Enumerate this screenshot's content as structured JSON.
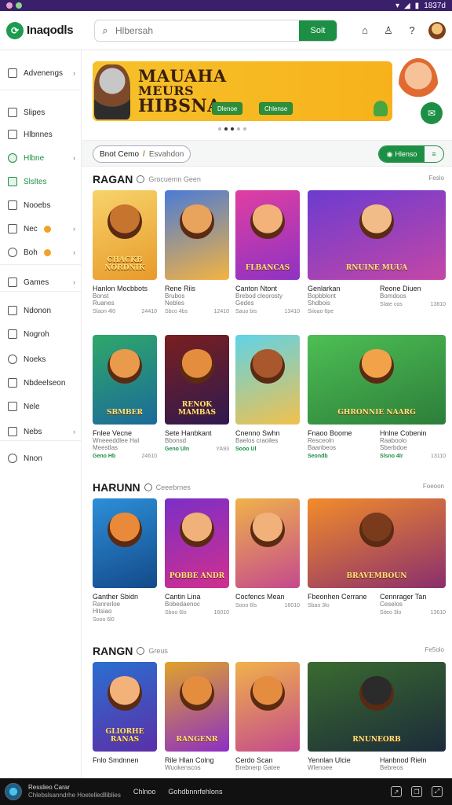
{
  "statusbar": {
    "time": "1837d"
  },
  "header": {
    "logo_text": "Inaqodls",
    "search_placeholder": "Hlbersah",
    "search_button": "Soit"
  },
  "sidebar": {
    "items": [
      {
        "label": "Advenengs",
        "icon": "home-icon"
      },
      {
        "label": "Slipes",
        "icon": "house-icon"
      },
      {
        "label": "Hlbnnes",
        "icon": "list-icon"
      },
      {
        "label": "Hlbne",
        "icon": "grid-icon",
        "active": true
      },
      {
        "label": "Slsltes",
        "icon": "checkbox-icon",
        "active": true
      },
      {
        "label": "Nooebs",
        "icon": "document-icon"
      },
      {
        "label": "Nec",
        "icon": "square-icon",
        "badge": true
      },
      {
        "label": "Boh",
        "icon": "square-icon",
        "badge": true
      },
      {
        "label": "Games",
        "icon": "gamepad-icon"
      },
      {
        "label": "Ndonon",
        "icon": "calendar-icon"
      },
      {
        "label": "Nogroh",
        "icon": "note-icon"
      },
      {
        "label": "Noeks",
        "icon": "book-icon"
      },
      {
        "label": "Nbdeelseon",
        "icon": "layout-icon"
      },
      {
        "label": "Nele",
        "icon": "mail-icon"
      },
      {
        "label": "Nebs",
        "icon": "tag-icon"
      },
      {
        "label": "Nnon",
        "icon": "gear-icon"
      }
    ]
  },
  "banner": {
    "line1": "MAUAHA",
    "line2": "MEURS",
    "line3": "HIBSNA",
    "btn1": "Dlenoe",
    "btn2": "Chlense"
  },
  "filters": {
    "pill_left": "Bnot Cemo",
    "pill_right": "Esvahdon",
    "toggle_label": "Hlenso"
  },
  "sections": [
    {
      "title": "RAGAN",
      "subtitle": "Grocuemn Geen",
      "see_all": "Feslo",
      "rows": [
        [
          {
            "name": "Hanlon Mocbbots",
            "sub1": "Bonst",
            "sub2": "Ruanes",
            "meta_a": "Slaon 4l0",
            "meta_b": "24410",
            "label": "CHACKB NORDNIK",
            "bg": "linear-gradient(160deg,#f7d36b,#e89a2a)",
            "face": "#c7742f"
          },
          {
            "name": "Rene Riis",
            "sub1": "Brubos",
            "sub2": "Nebles",
            "meta_a": "Sbco 4bs",
            "meta_b": "12410",
            "label": "",
            "bg": "linear-gradient(160deg,#4a7bd6,#f4b341)",
            "face": "#e8a35c"
          },
          {
            "name": "Canton Ntont",
            "sub1": "Brebod cleorosty",
            "sub2": "Gedes",
            "meta_a": "Sauo bis",
            "meta_b": "13410",
            "label": "FLBANCAS",
            "bg": "linear-gradient(160deg,#e03fa1,#8d32c4)",
            "face": "#f2b27a"
          },
          {
            "name": "Genlarkan",
            "sub1": "Bopbblont",
            "sub2": "Shdbois",
            "meta_a": "Siioao 6pe",
            "meta_b": "",
            "label": "RNUINE MUUA",
            "bg": "linear-gradient(160deg,#6c3bd0,#c447a6)",
            "face": "#f1bc87",
            "wide": true,
            "name2": "Reone Diuen",
            "sub1b": "Bomdoos",
            "sub2b": "",
            "meta_c": "Slate cos",
            "meta_d": "13810"
          }
        ],
        [
          {
            "name": "Fnlee Vecne",
            "sub1": "Wneeeddlee Hal",
            "sub2": "Meestlas",
            "meta_a": "Geno Hb",
            "meta_b": "24610",
            "label": "SBMBER",
            "bg": "linear-gradient(160deg,#2fa86a,#1b6a9a)",
            "face": "#e99a4a",
            "green": true
          },
          {
            "name": "Sete Hanbkant",
            "sub1": "Bbonsd",
            "sub2": "",
            "meta_a": "Geno Uln",
            "meta_b": "YA93",
            "label": "RENOK MAMBAS",
            "bg": "linear-gradient(160deg,#7a1f1f,#2f1a50)",
            "face": "#e58d3e",
            "green": true
          },
          {
            "name": "Cnenno Swhn",
            "sub1": "Baelos craoiles",
            "sub2": "",
            "meta_a": "Sooo Ul",
            "meta_b": "",
            "label": "",
            "bg": "linear-gradient(160deg,#5fd3e6,#f1c14d)",
            "face": "#a9572c",
            "green": true
          },
          {
            "name": "Fnaoo Boome",
            "sub1": "Resceoln",
            "sub2": "Baanbeos",
            "meta_a": "Seondb",
            "meta_b": "",
            "label": "GHRONNIE NAARG",
            "bg": "linear-gradient(160deg,#4dbf54,#2d7e3a)",
            "face": "#f2a34a",
            "wide": true,
            "name2": "Hnlne Cobenin",
            "sub1b": "Raaboolo",
            "sub2b": "Sberbdoe",
            "meta_c": "Slsno 4lr",
            "meta_d": "13110",
            "green": true
          }
        ]
      ]
    },
    {
      "title": "HARUNN",
      "subtitle": "Ceeebrnes",
      "see_all": "Foeoon",
      "rows": [
        [
          {
            "name": "Ganther Sbidn",
            "sub1": "Ranrerloe",
            "sub2": "Hitsiao",
            "meta_a": "Sooo 6l0",
            "meta_b": "",
            "label": "",
            "bg": "linear-gradient(160deg,#2d8fd8,#134a8a)",
            "face": "#e98a3a"
          },
          {
            "name": "Cantin Lina",
            "sub1": "Bobedaenoc",
            "sub2": "",
            "meta_a": "Sboo 6lo",
            "meta_b": "16010",
            "label": "POBBE ANDR",
            "bg": "linear-gradient(160deg,#7b2fc7,#d12f8e)",
            "face": "#f0b17a"
          },
          {
            "name": "Cocfencs Mean",
            "sub1": "",
            "sub2": "",
            "meta_a": "Sooo 6ls",
            "meta_b": "16010",
            "label": "",
            "bg": "linear-gradient(160deg,#7b2fc7,#d12f8e)",
            "face": "#f0b17a",
            "hidden_thumb": true
          },
          {
            "name": "Fbeonhen Cerrane",
            "sub1": "",
            "sub2": "",
            "meta_a": "Sbao 3lo",
            "meta_b": "",
            "label": "BRAVEMBOUN",
            "bg": "linear-gradient(160deg,#f28c2a,#8a2e6e)",
            "face": "#7a3a1c",
            "wide": true,
            "name2": "Cennrager Tan",
            "sub1b": "Ceselos",
            "sub2b": "",
            "meta_c": "Siteo 3lo",
            "meta_d": "13610"
          }
        ]
      ]
    },
    {
      "title": "RANGN",
      "subtitle": "Greus",
      "see_all": "Fe5olo",
      "rows": [
        [
          {
            "name": "Fnlo Smdnnen",
            "sub1": "",
            "sub2": "",
            "meta_a": "",
            "meta_b": "",
            "label": "GLIORHE RANAS",
            "bg": "linear-gradient(160deg,#2b6fd0,#5b2fa8)",
            "face": "#f2b27a"
          },
          {
            "name": "Rile Hlan Colng",
            "sub1": "Wuokenscos",
            "sub2": "",
            "meta_a": "",
            "meta_b": "",
            "label": "RANGENR",
            "bg": "linear-gradient(160deg,#e0a32a,#8d2fc4)",
            "face": "#e58d3e"
          },
          {
            "name": "Cerdo Scan",
            "sub1": "Brebnerp Gatee",
            "sub2": "",
            "meta_a": "",
            "meta_b": "",
            "label": "",
            "bg": "linear-gradient(160deg,#e0a32a,#8d2fc4)",
            "face": "#e58d3e",
            "hidden_thumb": true
          },
          {
            "name": "Yennlan Ulcie",
            "sub1": "Wlenoee",
            "sub2": "",
            "meta_a": "",
            "meta_b": "",
            "label": "RNUNEORB",
            "bg": "linear-gradient(160deg,#3a6b2f,#1c2b3a)",
            "face": "#2b2b2b",
            "wide": true,
            "name2": "Hanbnod Rieln",
            "sub1b": "Bebreos",
            "sub2b": "",
            "meta_c": "",
            "meta_d": ""
          }
        ]
      ]
    }
  ],
  "bottombar": {
    "line1": "Resslieo Carar",
    "line2": "Chlebslsanndrhe Hoetelledlliblies",
    "link1": "Chlnoo",
    "link2": "Gohdbnnrfehlons"
  }
}
